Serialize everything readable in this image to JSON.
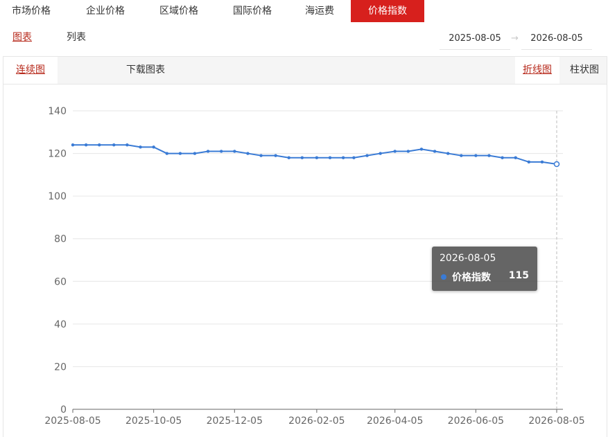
{
  "tabs": [
    {
      "label": "市场价格",
      "active": false
    },
    {
      "label": "企业价格",
      "active": false
    },
    {
      "label": "区域价格",
      "active": false
    },
    {
      "label": "国际价格",
      "active": false
    },
    {
      "label": "海运费",
      "active": false
    },
    {
      "label": "价格指数",
      "active": true
    }
  ],
  "subnav": {
    "chart_label": "图表",
    "list_label": "列表"
  },
  "date_range": {
    "start": "2025-08-05",
    "end": "2026-08-05",
    "arrow": "→"
  },
  "toolbar": {
    "continuous_label": "连续图",
    "download_label": "下载图表",
    "line_label": "折线图",
    "bar_label": "柱状图"
  },
  "tooltip": {
    "date": "2026-08-05",
    "series": "价格指数",
    "value": "115"
  },
  "colors": {
    "accent": "#d7201d",
    "link": "#b72a1c",
    "line": "#3a7bd5"
  },
  "chart_data": {
    "type": "line",
    "title": "",
    "xlabel": "",
    "ylabel": "",
    "ylim": [
      0,
      140
    ],
    "yticks": [
      0,
      20,
      40,
      60,
      80,
      100,
      120,
      140
    ],
    "xlim": [
      "2025-08-05",
      "2026-08-05"
    ],
    "xticks": [
      "2025-08-05",
      "2025-10-05",
      "2025-12-05",
      "2026-02-05",
      "2026-04-05",
      "2026-06-05",
      "2026-08-05"
    ],
    "grid": true,
    "series": [
      {
        "name": "价格指数",
        "x": [
          "2025-08-05",
          "2025-08-15",
          "2025-08-25",
          "2025-09-05",
          "2025-09-15",
          "2025-09-25",
          "2025-10-05",
          "2025-10-15",
          "2025-10-25",
          "2025-11-05",
          "2025-11-15",
          "2025-11-25",
          "2025-12-05",
          "2025-12-15",
          "2025-12-25",
          "2026-01-05",
          "2026-01-15",
          "2026-01-25",
          "2026-02-05",
          "2026-02-15",
          "2026-02-25",
          "2026-03-05",
          "2026-03-15",
          "2026-03-25",
          "2026-04-05",
          "2026-04-15",
          "2026-04-25",
          "2026-05-05",
          "2026-05-15",
          "2026-05-25",
          "2026-06-05",
          "2026-06-15",
          "2026-06-25",
          "2026-07-05",
          "2026-07-15",
          "2026-07-25",
          "2026-08-05"
        ],
        "values": [
          124,
          124,
          124,
          124,
          124,
          123,
          123,
          120,
          120,
          120,
          121,
          121,
          121,
          120,
          119,
          119,
          118,
          118,
          118,
          118,
          118,
          118,
          119,
          120,
          121,
          121,
          122,
          121,
          120,
          119,
          119,
          119,
          118,
          118,
          116,
          116,
          115
        ]
      }
    ]
  }
}
